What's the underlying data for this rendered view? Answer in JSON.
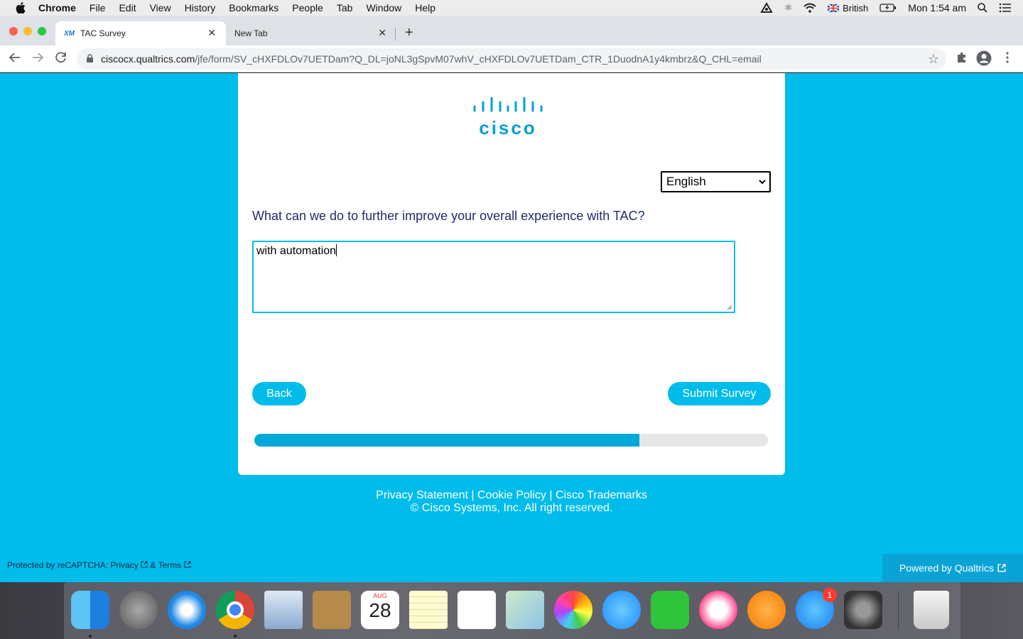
{
  "menubar": {
    "app": "Chrome",
    "items": [
      "File",
      "Edit",
      "View",
      "History",
      "Bookmarks",
      "People",
      "Tab",
      "Window",
      "Help"
    ],
    "input_source": "British",
    "clock": "Mon 1:54 am"
  },
  "browser": {
    "tabs": [
      {
        "favicon": "XM",
        "title": "TAC Survey"
      },
      {
        "title": "New Tab"
      }
    ],
    "url_host": "ciscocx.qualtrics.com",
    "url_path": "/jfe/form/SV_cHXFDLOv7UETDam?Q_DL=joNL3gSpvM07whV_cHXFDLOv7UETDam_CTR_1DuodnA1y4kmbrz&Q_CHL=email"
  },
  "survey": {
    "logo_text": "cisco",
    "language": "English",
    "question": "What can we do to further improve your overall experience with TAC?",
    "answer": "with automation",
    "back_label": "Back",
    "submit_label": "Submit Survey",
    "progress_fraction": 0.75
  },
  "footer": {
    "privacy": "Privacy Statement",
    "cookie": "Cookie Policy",
    "trademarks": "Cisco Trademarks",
    "separator": "|",
    "copyright": "© Cisco Systems, Inc. All right reserved.",
    "recaptcha": "Protected by reCAPTCHA: Privacy",
    "recaptcha_terms": "& Terms",
    "powered_by": "Powered by Qualtrics"
  },
  "dock": {
    "calendar_month": "AUG",
    "calendar_day": "28",
    "appstore_badge": "1",
    "apps": [
      "finder-icon",
      "launchpad-icon",
      "safari-icon",
      "chrome-icon",
      "mail-icon",
      "contacts-icon",
      "calendar-icon",
      "notes-icon",
      "reminders-icon",
      "maps-icon",
      "photos-icon",
      "messages-icon",
      "facetime-icon",
      "itunes-icon",
      "books-icon",
      "app-store-icon",
      "system-preferences-icon",
      "trash-icon"
    ]
  },
  "colors": {
    "page_bg": "#00bceb",
    "accent": "#00bceb",
    "question_text": "#1d2d6b"
  }
}
